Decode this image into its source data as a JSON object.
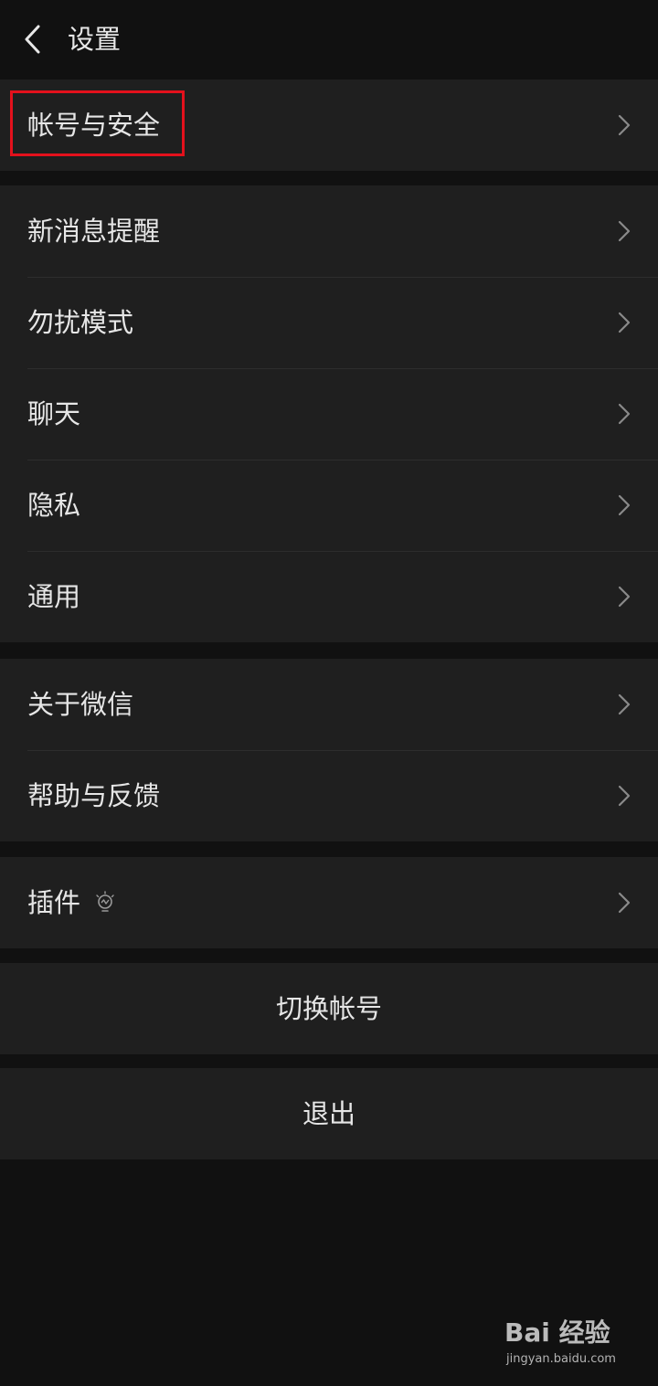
{
  "header": {
    "back_icon": "chevron-left-icon",
    "title": "设置"
  },
  "highlight": {
    "target": "account-security",
    "color": "#e3111c"
  },
  "groups": [
    {
      "items": [
        {
          "label": "帐号与安全",
          "icon": "chevron-right-icon"
        }
      ]
    },
    {
      "items": [
        {
          "label": "新消息提醒",
          "icon": "chevron-right-icon"
        },
        {
          "label": "勿扰模式",
          "icon": "chevron-right-icon"
        },
        {
          "label": "聊天",
          "icon": "chevron-right-icon"
        },
        {
          "label": "隐私",
          "icon": "chevron-right-icon"
        },
        {
          "label": "通用",
          "icon": "chevron-right-icon"
        }
      ]
    },
    {
      "items": [
        {
          "label": "关于微信",
          "icon": "chevron-right-icon"
        },
        {
          "label": "帮助与反馈",
          "icon": "chevron-right-icon"
        }
      ]
    },
    {
      "items": [
        {
          "label": "插件",
          "badge_icon": "lightbulb-icon",
          "icon": "chevron-right-icon"
        }
      ]
    }
  ],
  "actions": {
    "switch_account": "切换帐号",
    "logout": "退出"
  },
  "watermark": {
    "logo_text": "Bai 经验",
    "url": "jingyan.baidu.com"
  },
  "colors": {
    "background": "#111111",
    "cell": "#1f1f1f",
    "separator": "#2d2d2d",
    "text": "#e6e6e6",
    "chevron": "#8a8a8a"
  }
}
